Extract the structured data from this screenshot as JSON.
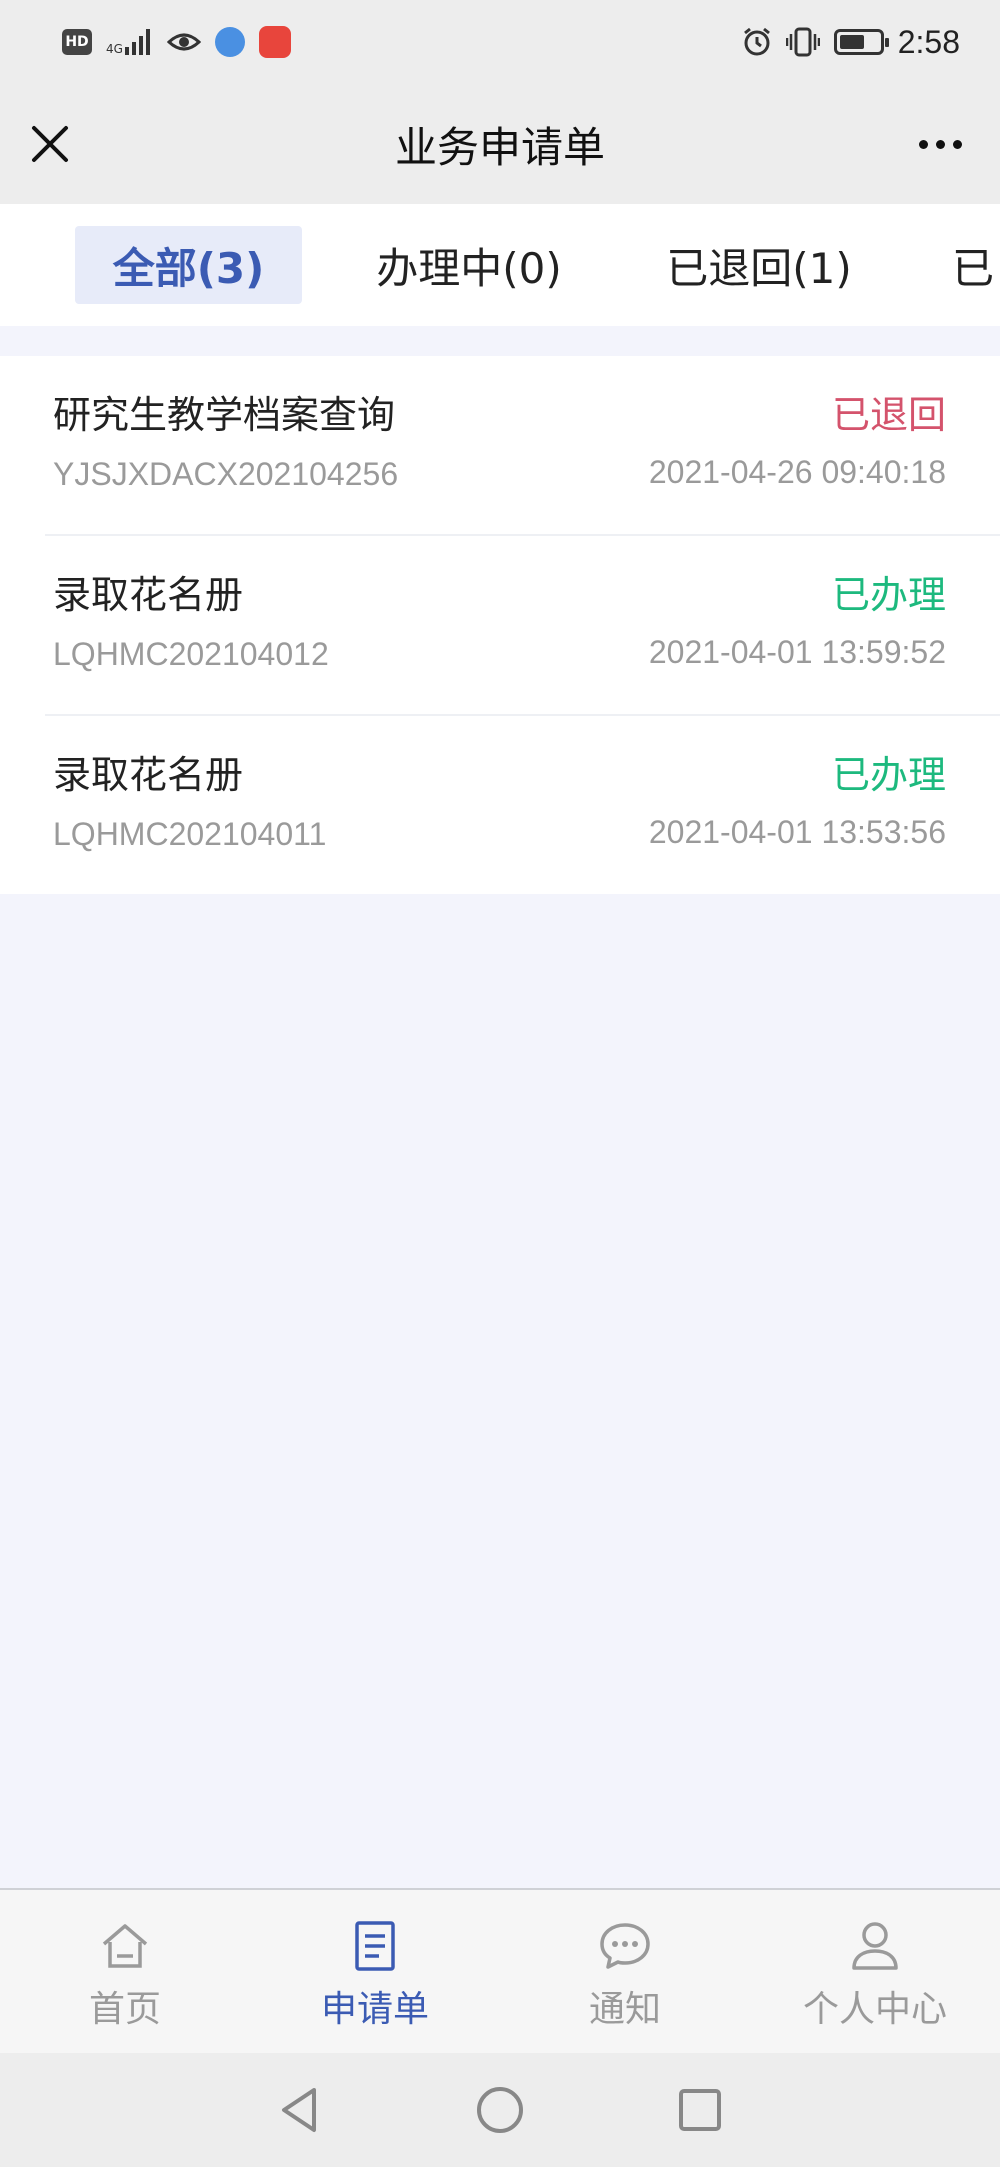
{
  "status_bar": {
    "hd": "HD",
    "network": "4G",
    "time": "2:58"
  },
  "header": {
    "title": "业务申请单"
  },
  "tabs": [
    {
      "label": "全部(3)",
      "active": true
    },
    {
      "label": "办理中(0)",
      "active": false
    },
    {
      "label": "已退回(1)",
      "active": false
    },
    {
      "label": "已",
      "active": false
    }
  ],
  "requests": [
    {
      "title": "研究生教学档案查询",
      "status": "已退回",
      "status_color": "#d4536c",
      "code": "YJSJXDACX202104256",
      "time": "2021-04-26 09:40:18"
    },
    {
      "title": "录取花名册",
      "status": "已办理",
      "status_color": "#1db97e",
      "code": "LQHMC202104012",
      "time": "2021-04-01 13:59:52"
    },
    {
      "title": "录取花名册",
      "status": "已办理",
      "status_color": "#1db97e",
      "code": "LQHMC202104011",
      "time": "2021-04-01 13:53:56"
    }
  ],
  "bottom_nav": [
    {
      "label": "首页",
      "icon": "home-icon",
      "active": false
    },
    {
      "label": "申请单",
      "icon": "document-icon",
      "active": true
    },
    {
      "label": "通知",
      "icon": "chat-bubble-icon",
      "active": false
    },
    {
      "label": "个人中心",
      "icon": "person-icon",
      "active": false
    }
  ],
  "colors": {
    "accent": "#3b5bb3",
    "returned": "#d4536c",
    "done": "#1db97e"
  }
}
